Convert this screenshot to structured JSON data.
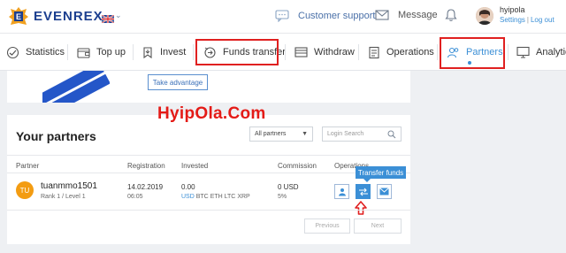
{
  "brand": {
    "name": "EVENREX",
    "color": "#1c3f8f",
    "accent": "#3b8fd6"
  },
  "topbar": {
    "customer_support": "Customer support",
    "message": "Message",
    "user": {
      "name": "hyipola",
      "settings": "Settings",
      "logout": "Log out"
    },
    "language": "uk-flag-icon"
  },
  "nav": {
    "items": [
      {
        "label": "Statistics",
        "icon": "statistics-icon"
      },
      {
        "label": "Top up",
        "icon": "wallet-icon"
      },
      {
        "label": "Invest",
        "icon": "invest-icon"
      },
      {
        "label": "Funds transfer",
        "icon": "funds-transfer-icon"
      },
      {
        "label": "Withdraw",
        "icon": "withdraw-icon"
      },
      {
        "label": "Operations",
        "icon": "operations-icon"
      },
      {
        "label": "Partners",
        "icon": "partners-icon"
      },
      {
        "label": "Analytics",
        "icon": "analytics-icon"
      }
    ],
    "active": "Partners"
  },
  "banner": {
    "button": "Take advantage"
  },
  "watermark": "HyipOla.Com",
  "partners": {
    "title": "Your partners",
    "filter": "All partners",
    "search_placeholder": "Login Search",
    "columns": [
      "Partner",
      "Registration",
      "Invested",
      "Commission",
      "Operations"
    ],
    "rows": [
      {
        "initials": "TU",
        "login": "tuanmmo1501",
        "rank": "Rank 1 / Level 1",
        "reg_date": "14.02.2019",
        "reg_time": "06:05",
        "invested": "0.00",
        "currencies": [
          "USD",
          "BTC",
          "ETH",
          "LTC",
          "XRP"
        ],
        "commission": "0 USD",
        "commission_pct": "5%"
      }
    ],
    "tooltip": "Transfer funds",
    "pagination": {
      "prev": "Previous",
      "next": "Next"
    }
  }
}
